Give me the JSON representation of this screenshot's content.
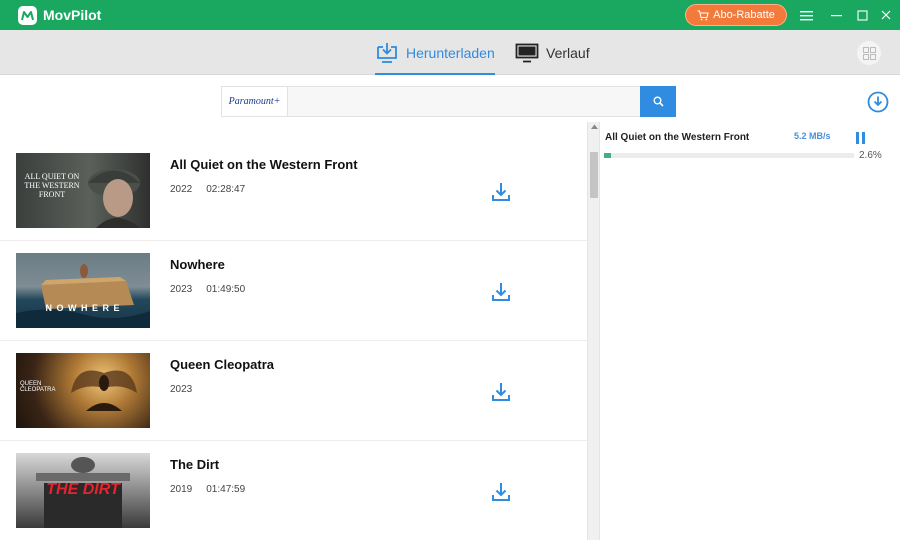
{
  "app": {
    "title": "MovPilot"
  },
  "promo": {
    "label": "Abo-Rabatte",
    "color": "#f37a3a"
  },
  "colors": {
    "titlebar": "#1aa861",
    "accent": "#2f8ce0",
    "progress": "#3fae8a"
  },
  "tabs": [
    {
      "label": "Herunterladen",
      "icon": "download-monitor-icon",
      "active": true
    },
    {
      "label": "Verlauf",
      "icon": "monitor-icon",
      "active": false
    }
  ],
  "search": {
    "provider": "Paramount+",
    "placeholder": ""
  },
  "movies": [
    {
      "title": "All Quiet on the Western Front",
      "year": "2022",
      "duration": "02:28:47",
      "poster_text": "ALL QUIET ON THE WESTERN FRONT"
    },
    {
      "title": "Nowhere",
      "year": "2023",
      "duration": "01:49:50",
      "poster_text": "N O W H E R E"
    },
    {
      "title": "Queen Cleopatra",
      "year": "2023",
      "duration": "",
      "poster_text": "QUEEN CLEOPATRA"
    },
    {
      "title": "The Dirt",
      "year": "2019",
      "duration": "01:47:59",
      "poster_text": "THE DIRT"
    }
  ],
  "download_task": {
    "title": "All Quiet on the Western Front",
    "speed": "5.2 MB/s",
    "progress_label": "2.6%",
    "progress": 0.026
  }
}
